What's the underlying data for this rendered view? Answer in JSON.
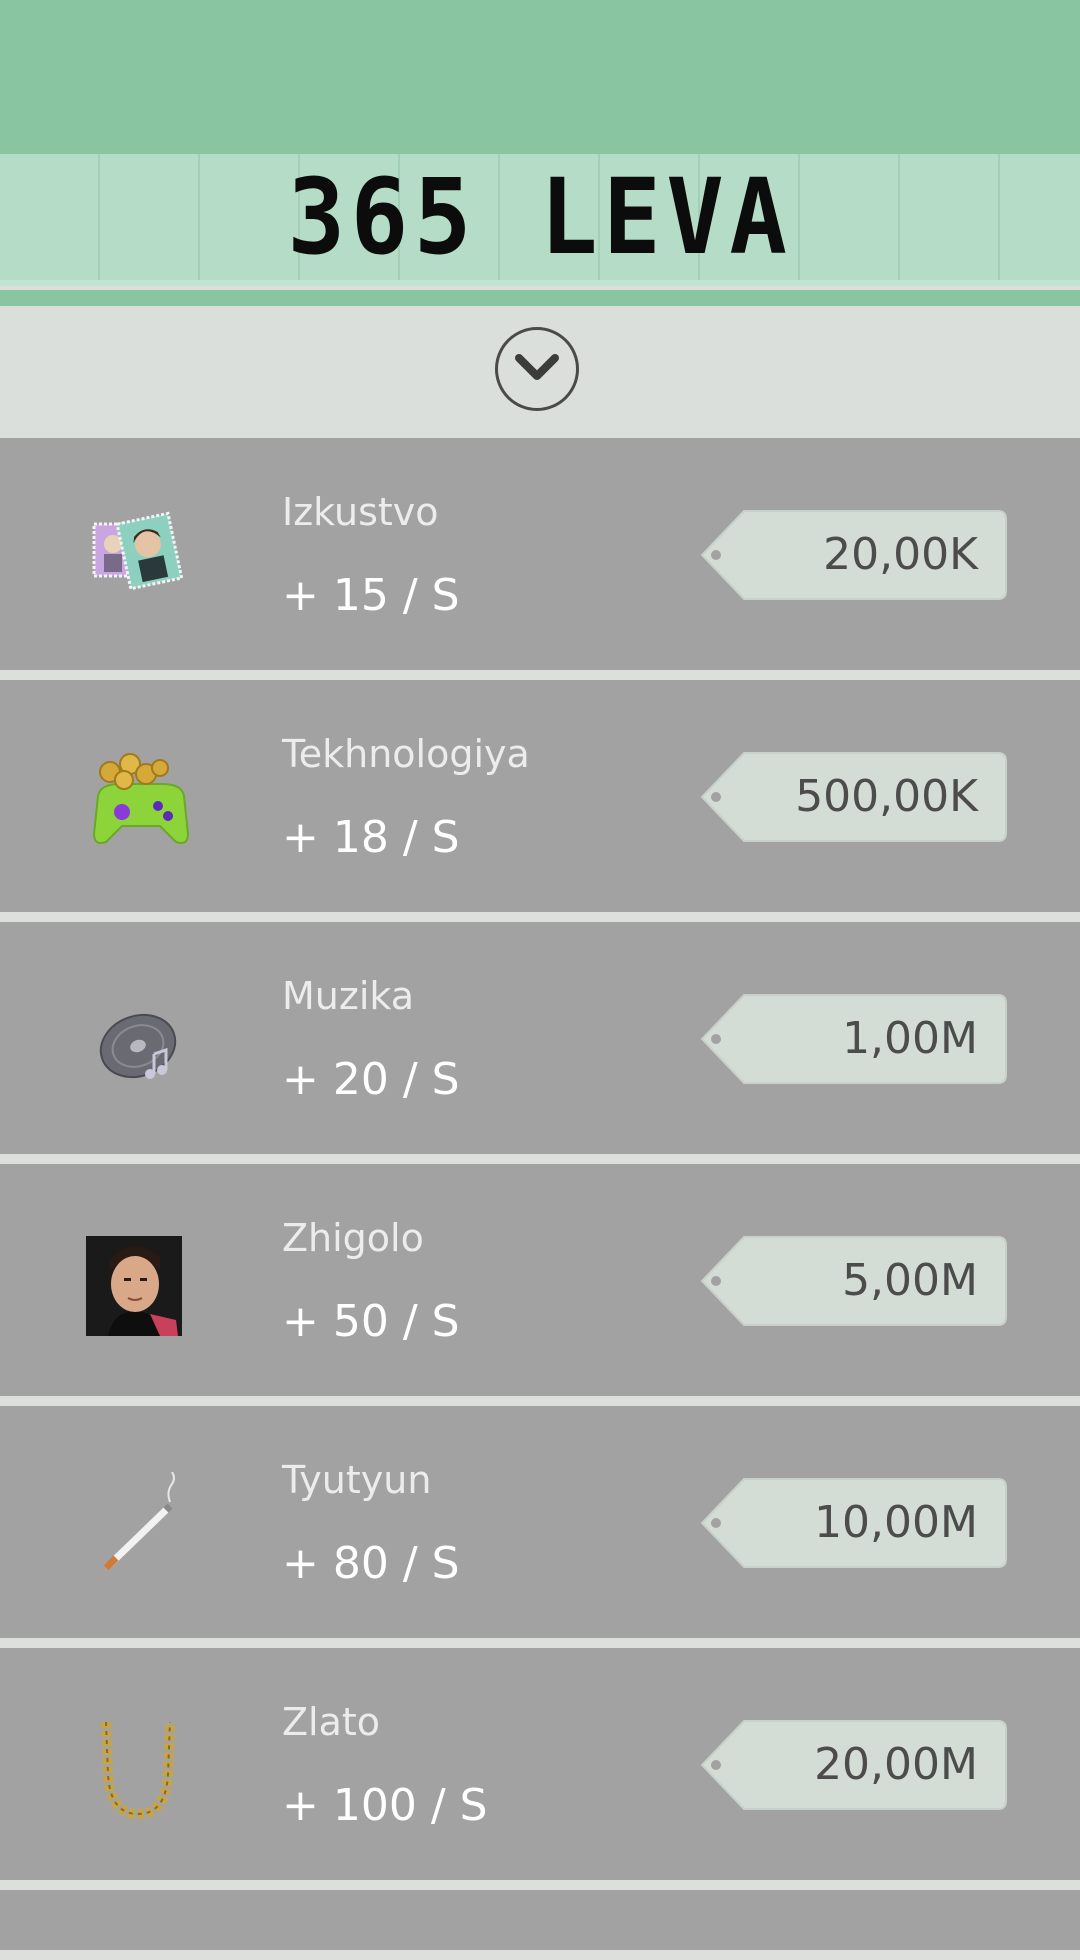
{
  "counter": {
    "value": "365 LEVA"
  },
  "toggle": {
    "icon": "chevron-down-icon"
  },
  "items": [
    {
      "name": "Izkustvo",
      "rate": "+ 15 / S",
      "price": "20,00K",
      "icon": "stamps-icon"
    },
    {
      "name": "Tekhnologiya",
      "rate": "+ 18 / S",
      "price": "500,00K",
      "icon": "gamepad-coins-icon"
    },
    {
      "name": "Muzika",
      "rate": "+ 20 / S",
      "price": "1,00M",
      "icon": "vinyl-record-icon"
    },
    {
      "name": "Zhigolo",
      "rate": "+ 50 / S",
      "price": "5,00M",
      "icon": "man-portrait-icon"
    },
    {
      "name": "Tyutyun",
      "rate": "+ 80 / S",
      "price": "10,00M",
      "icon": "cigarette-icon"
    },
    {
      "name": "Zlato",
      "rate": "+ 100 / S",
      "price": "20,00M",
      "icon": "gold-chain-icon"
    }
  ],
  "colors": {
    "header_green": "#8ac5a2",
    "counter_green": "#b4dcc6",
    "row_gray": "#a2a2a2",
    "tag_fill": "#d4dcd6"
  }
}
